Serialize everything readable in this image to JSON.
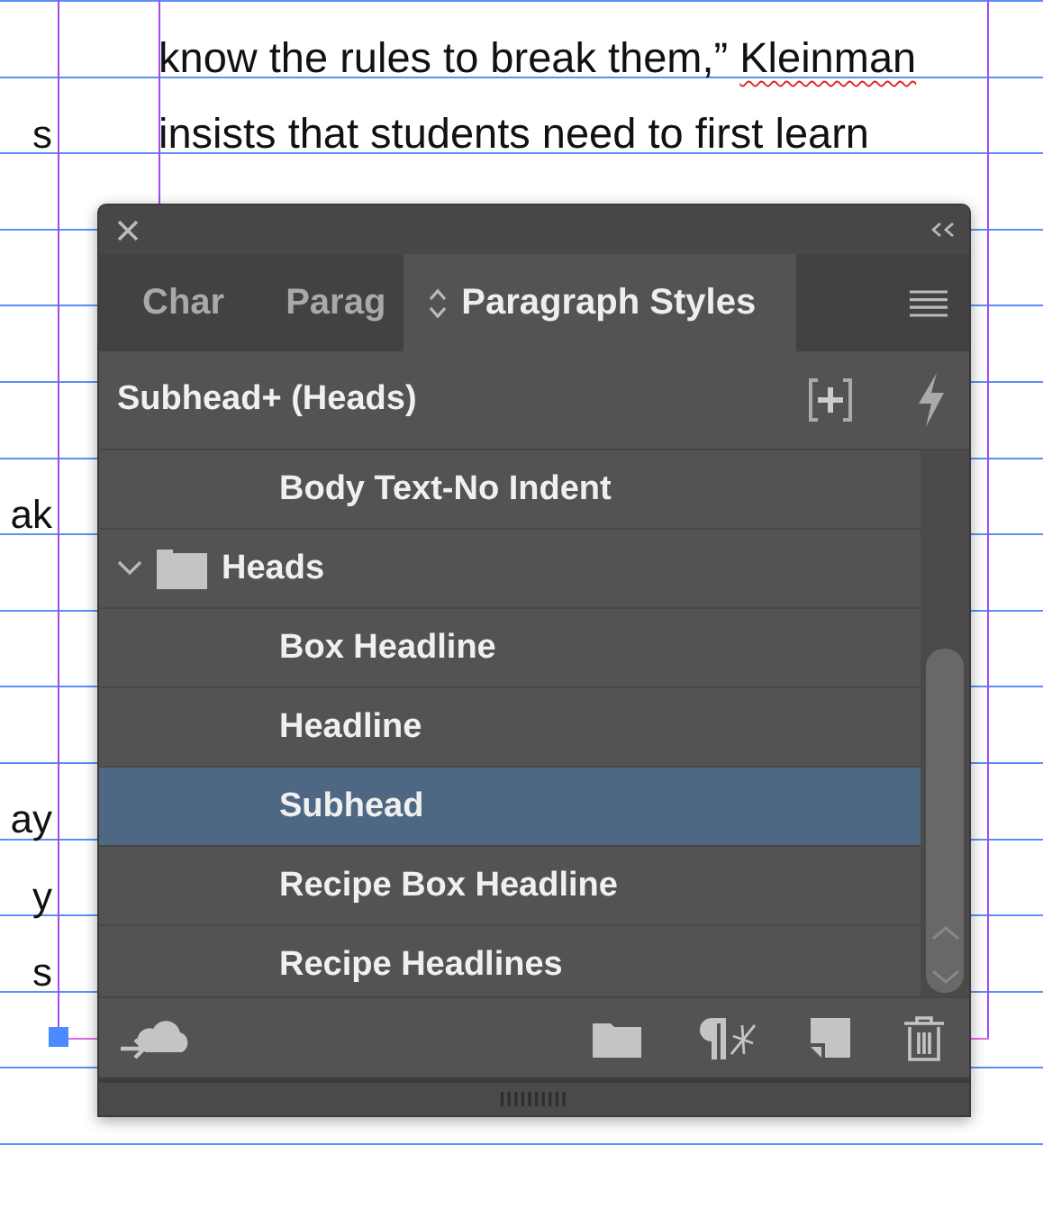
{
  "document": {
    "lines": [
      {
        "text": "know the rules to break them,” ",
        "flagged": "Kleinman"
      },
      {
        "text": "insists that students need to first learn"
      }
    ],
    "margin_fragments": [
      "s",
      "ak",
      "ay",
      "y",
      "s"
    ]
  },
  "panel": {
    "tabs": [
      {
        "label": "Char",
        "selected": false
      },
      {
        "label": "Parag",
        "selected": false
      },
      {
        "label": "Paragraph Styles",
        "selected": true
      }
    ],
    "current_style": "Subhead+ (Heads)",
    "styles": [
      {
        "kind": "style",
        "name": "Body Text-No Indent",
        "selected": false
      },
      {
        "kind": "group",
        "name": "Heads",
        "expanded": true,
        "children": [
          {
            "kind": "style",
            "name": "Box Headline",
            "selected": false
          },
          {
            "kind": "style",
            "name": "Headline",
            "selected": false
          },
          {
            "kind": "style",
            "name": "Subhead",
            "selected": true
          },
          {
            "kind": "style",
            "name": "Recipe Box Headline",
            "selected": false
          },
          {
            "kind": "style",
            "name": "Recipe Headlines",
            "selected": false
          }
        ]
      }
    ]
  }
}
